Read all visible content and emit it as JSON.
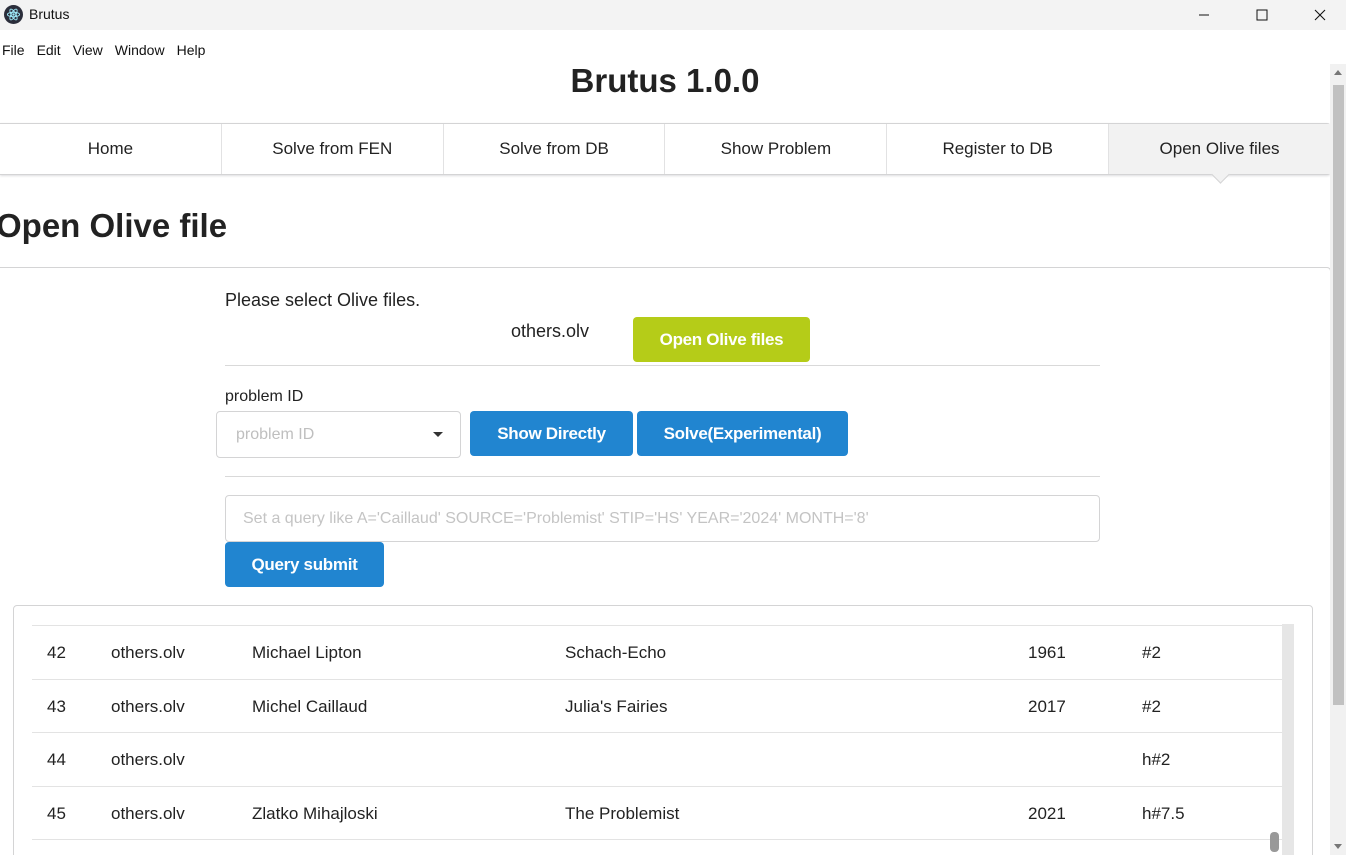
{
  "window": {
    "title": "Brutus",
    "icon": "atom-icon"
  },
  "menu": [
    "File",
    "Edit",
    "View",
    "Window",
    "Help"
  ],
  "header": {
    "title": "Brutus 1.0.0"
  },
  "tabs": [
    {
      "label": "Home"
    },
    {
      "label": "Solve from FEN"
    },
    {
      "label": "Solve from DB"
    },
    {
      "label": "Show Problem"
    },
    {
      "label": "Register to DB"
    },
    {
      "label": "Open Olive files",
      "active": true
    }
  ],
  "page": {
    "title": "Open Olive file",
    "instruction": "Please select Olive files.",
    "selected_file": "others.olv",
    "open_button": "Open Olive files",
    "problem_id_label": "problem ID",
    "problem_id_placeholder": "problem ID",
    "show_button": "Show Directly",
    "solve_button": "Solve(Experimental)",
    "query_placeholder": "Set a query like A='Caillaud' SOURCE='Problemist' STIP='HS' YEAR='2024' MONTH='8'",
    "query_button": "Query submit"
  },
  "table": {
    "rows": [
      {
        "id": "42",
        "file": "others.olv",
        "author": "Michael Lipton",
        "source": "Schach-Echo",
        "year": "1961",
        "stip": "#2"
      },
      {
        "id": "43",
        "file": "others.olv",
        "author": "Michel Caillaud",
        "source": "Julia's Fairies",
        "year": "2017",
        "stip": "#2"
      },
      {
        "id": "44",
        "file": "others.olv",
        "author": "",
        "source": "",
        "year": "",
        "stip": "h#2"
      },
      {
        "id": "45",
        "file": "others.olv",
        "author": "Zlatko Mihajloski",
        "source": "The Problemist",
        "year": "2021",
        "stip": "h#7.5"
      }
    ]
  },
  "colors": {
    "olive": "#b5cc18",
    "blue": "#2185d0",
    "active_tab": "#f2f2f2"
  }
}
